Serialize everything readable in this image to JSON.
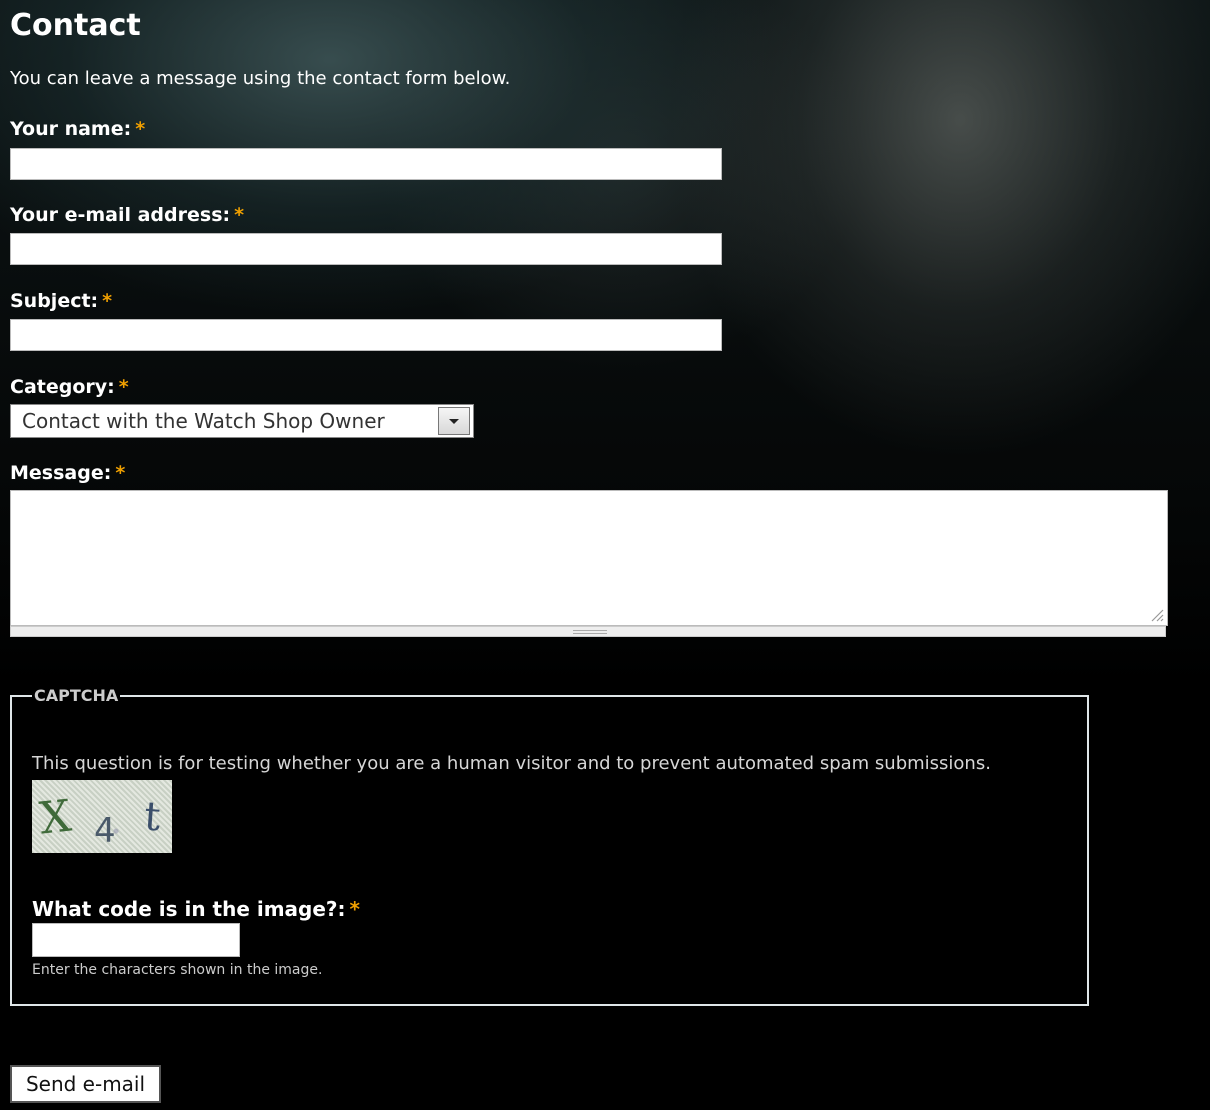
{
  "page": {
    "title": "Contact",
    "intro": "You can leave a message using the contact form below."
  },
  "form": {
    "required_mark": "*",
    "name": {
      "label": "Your name:",
      "value": ""
    },
    "email": {
      "label": "Your e-mail address:",
      "value": ""
    },
    "subject": {
      "label": "Subject:",
      "value": ""
    },
    "category": {
      "label": "Category:",
      "selected": "Contact with the Watch Shop Owner"
    },
    "message": {
      "label": "Message:",
      "value": ""
    },
    "submit_label": "Send e-mail"
  },
  "captcha": {
    "legend": "CAPTCHA",
    "description": "This question is for testing whether you are a human visitor and to prevent automated spam submissions.",
    "image_text": "X4t",
    "code_label": "What code is in the image?:",
    "help": "Enter the characters shown in the image."
  },
  "colors": {
    "required": "#f0a000",
    "background": "#000000",
    "fieldset_border": "#dfe6e8"
  }
}
